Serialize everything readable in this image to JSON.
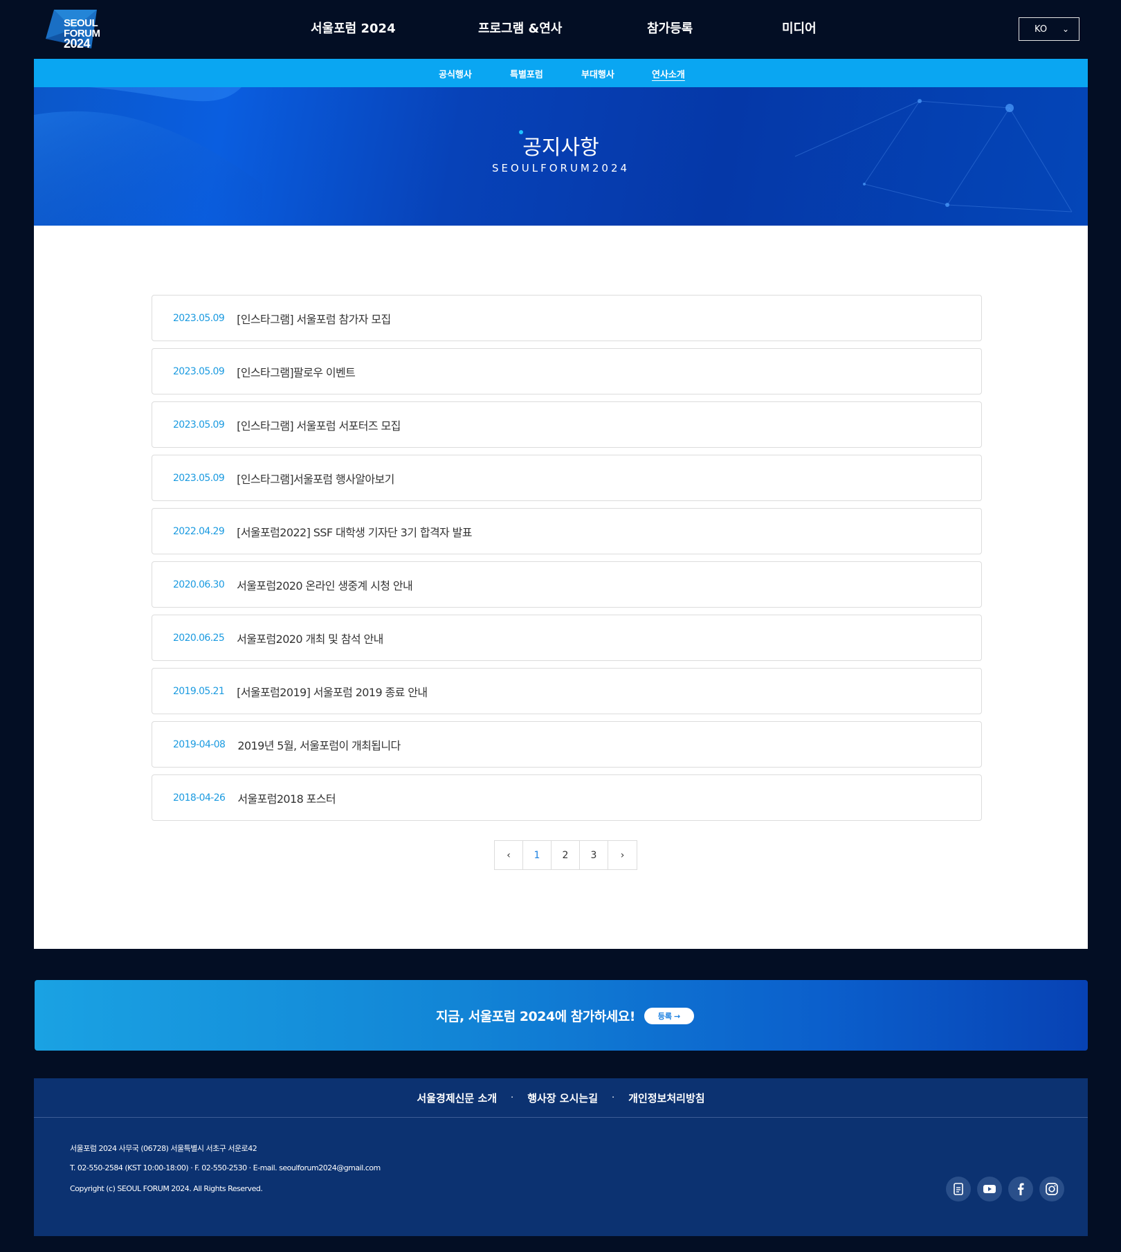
{
  "header": {
    "logo": {
      "line1": "SEOUL",
      "line2": "FORUM",
      "year": "2024"
    },
    "nav": [
      {
        "label": "서울포럼 2024"
      },
      {
        "label": "프로그램 &연사"
      },
      {
        "label": "참가등록"
      },
      {
        "label": "미디어"
      }
    ],
    "language": {
      "selected": "KO",
      "chevron": "⌄"
    }
  },
  "subnav": {
    "items": [
      {
        "label": "공식행사"
      },
      {
        "label": "특별포럼"
      },
      {
        "label": "부대행사"
      },
      {
        "label": "연사소개"
      }
    ],
    "active_index": 3
  },
  "hero": {
    "title": "공지사항",
    "subtitle": "SEOULFORUM2024"
  },
  "notices": [
    {
      "date": "2023.05.09",
      "title": "[인스타그램] 서울포럼 참가자 모집"
    },
    {
      "date": "2023.05.09",
      "title": "[인스타그램]팔로우 이벤트"
    },
    {
      "date": "2023.05.09",
      "title": "[인스타그램] 서울포럼 서포터즈 모집"
    },
    {
      "date": "2023.05.09",
      "title": "[인스타그램]서울포럼 행사알아보기"
    },
    {
      "date": "2022.04.29",
      "title": "[서울포럼2022] SSF 대학생 기자단 3기 합격자 발표"
    },
    {
      "date": "2020.06.30",
      "title": "서울포럼2020 온라인 생중계 시청 안내"
    },
    {
      "date": "2020.06.25",
      "title": "서울포럼2020 개최 및 참석 안내"
    },
    {
      "date": "2019.05.21",
      "title": "[서울포럼2019] 서울포럼 2019 종료 안내"
    },
    {
      "date": "2019-04-08",
      "title": "2019년 5월, 서울포럼이 개최됩니다"
    },
    {
      "date": "2018-04-26",
      "title": "서울포럼2018 포스터"
    }
  ],
  "pagination": {
    "prev": "‹",
    "pages": [
      "1",
      "2",
      "3"
    ],
    "current": "1",
    "next": "›"
  },
  "cta": {
    "text": "지금, 서울포럼 2024에 참가하세요!",
    "button_label": "등록",
    "button_arrow": "→"
  },
  "footer": {
    "links": [
      {
        "label": "서울경제신문 소개"
      },
      {
        "label": "행사장 오시는길"
      },
      {
        "label": "개인정보처리방침"
      }
    ],
    "separator": "·",
    "info": [
      "서울포럼 2024 사무국 (06728) 서울특별시 서초구 서운로42",
      "T. 02-550-2584 (KST 10:00-18:00) · F. 02-550-2530 · E-mail. seoulforum2024@gmail.com",
      "Copyright (c) SEOUL FORUM 2024. All Rights Reserved."
    ],
    "social_icons": [
      "blog-icon",
      "youtube-icon",
      "facebook-icon",
      "instagram-icon"
    ]
  },
  "colors": {
    "background": "#030e24",
    "subnav": "#0aa6f2",
    "date_accent": "#1a9ae0",
    "footer": "#0c3271"
  }
}
